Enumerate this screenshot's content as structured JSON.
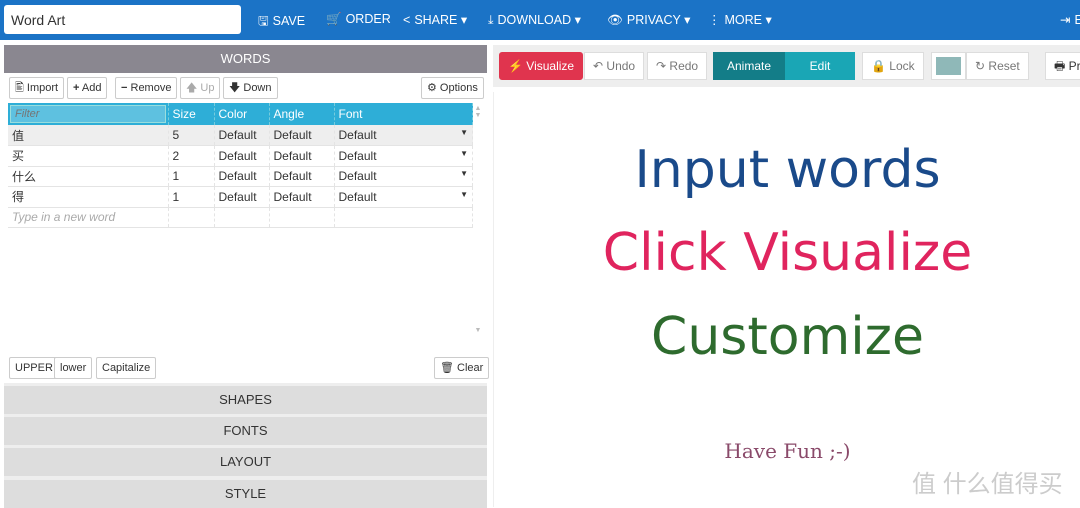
{
  "header": {
    "title_value": "Word Art",
    "nav": [
      {
        "icon": "save-icon",
        "glyph": "🖫",
        "label": "SAVE"
      },
      {
        "icon": "cart-icon",
        "glyph": "🛒",
        "label": "ORDER"
      },
      {
        "icon": "share-icon",
        "glyph": "<",
        "label": "SHARE ▾"
      },
      {
        "icon": "download-icon",
        "glyph": "⤓",
        "label": "DOWNLOAD ▾"
      },
      {
        "icon": "eye-slash-icon",
        "glyph": "👁",
        "label": "PRIVACY ▾"
      },
      {
        "icon": "more-vertical-icon",
        "glyph": "⋮",
        "label": "MORE ▾"
      },
      {
        "icon": "sign-in-icon",
        "glyph": "⇥",
        "label": "E"
      }
    ]
  },
  "words": {
    "title": "WORDS",
    "toolbar": {
      "import": "Import",
      "add": "Add",
      "remove": "Remove",
      "up": "Up",
      "down": "Down",
      "options": "Options"
    },
    "filter_placeholder": "Filter",
    "columns": [
      "Size",
      "Color",
      "Angle",
      "Font"
    ],
    "rows": [
      {
        "word": "值",
        "size": "5",
        "color": "Default",
        "angle": "Default",
        "font": "Default"
      },
      {
        "word": "买",
        "size": "2",
        "color": "Default",
        "angle": "Default",
        "font": "Default"
      },
      {
        "word": "什么",
        "size": "1",
        "color": "Default",
        "angle": "Default",
        "font": "Default"
      },
      {
        "word": "得",
        "size": "1",
        "color": "Default",
        "angle": "Default",
        "font": "Default"
      }
    ],
    "new_word_placeholder": "Type in a new word",
    "case": {
      "upper": "UPPER",
      "lower": "lower",
      "capitalize": "Capitalize",
      "clear": "Clear"
    }
  },
  "sections": [
    "SHAPES",
    "FONTS",
    "LAYOUT",
    "STYLE"
  ],
  "canvas_toolbar": {
    "visualize": "Visualize",
    "undo": "Undo",
    "redo": "Redo",
    "animate": "Animate",
    "edit": "Edit",
    "lock": "Lock",
    "reset": "Reset",
    "print": "Pr",
    "swatch_color": "#8fb8b8"
  },
  "canvas": {
    "lines": [
      {
        "text": "Input words",
        "color": "#1a4a8a"
      },
      {
        "text": "Click Visualize",
        "color": "#e0245e"
      },
      {
        "text": "Customize",
        "color": "#2e6b2e"
      },
      {
        "text": "Have Fun ;-)",
        "color": "#8a4a6a"
      }
    ]
  },
  "watermark": "值 什么值得买"
}
